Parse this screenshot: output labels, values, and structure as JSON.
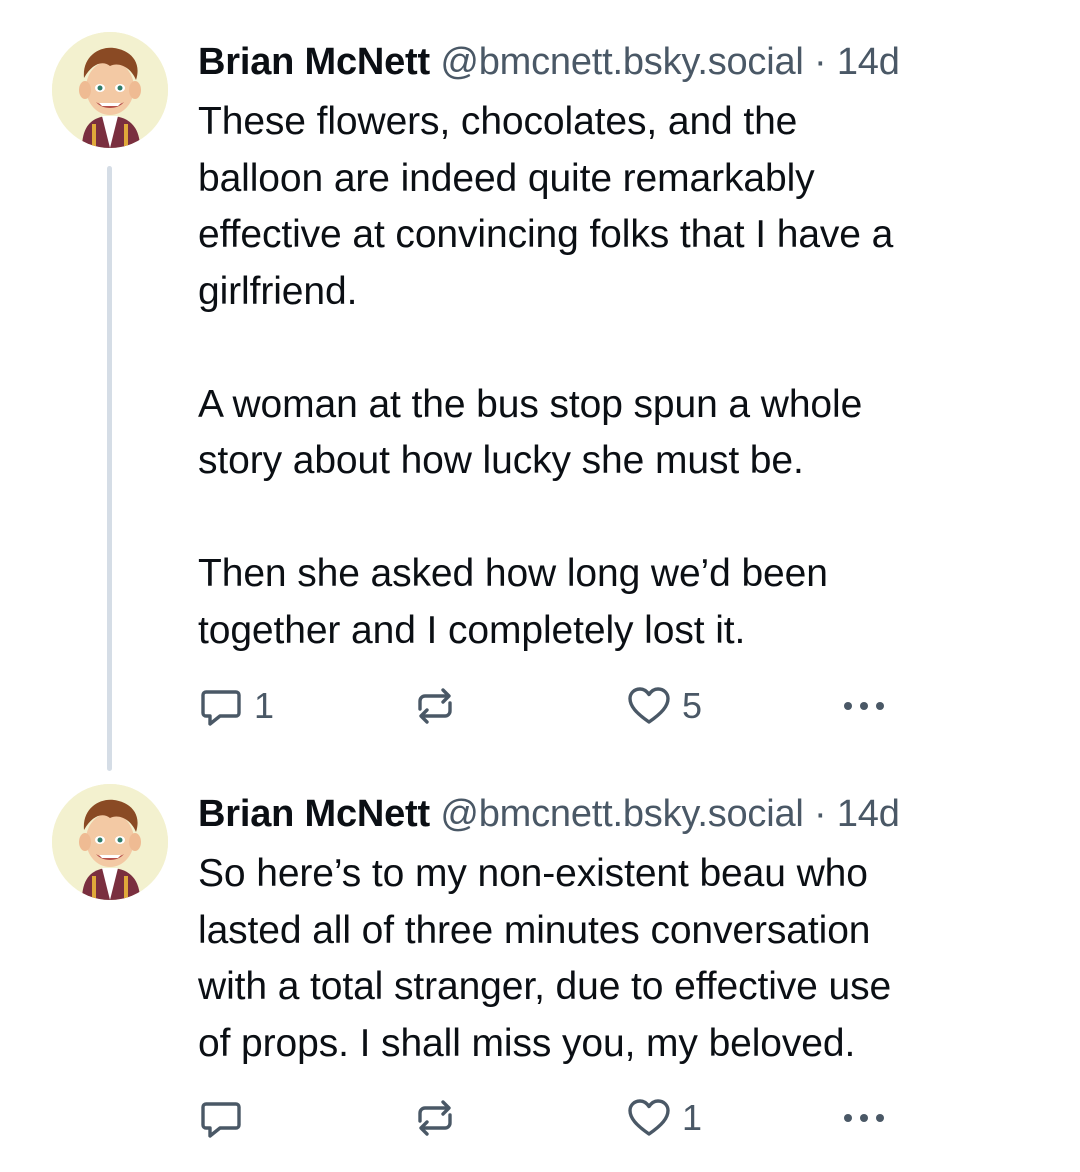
{
  "thread": {
    "posts": [
      {
        "author": {
          "display_name": "Brian McNett",
          "handle": "@bmcnett.bsky.social",
          "separator": "·",
          "time": "14d"
        },
        "text": "These flowers, chocolates, and the\nballoon are indeed quite remarkably\neffective at convincing folks that I have a\ngirlfriend.\n\nA woman at the bus stop spun a whole\nstory about how lucky she must be.\n\nThen she asked how long we’d been\ntogether and I completely lost it.",
        "actions": {
          "reply_count": "1",
          "repost_count": "",
          "like_count": "5",
          "reply_icon": "reply-icon",
          "repost_icon": "repost-icon",
          "like_icon": "heart-icon",
          "more_icon": "more-icon"
        }
      },
      {
        "author": {
          "display_name": "Brian McNett",
          "handle": "@bmcnett.bsky.social",
          "separator": "·",
          "time": "14d"
        },
        "text": "So here’s to my non-existent beau who\nlasted all of three minutes conversation\nwith a total stranger, due to effective use\nof props. I shall miss you, my beloved.",
        "actions": {
          "reply_count": "",
          "repost_count": "",
          "like_count": "1",
          "reply_icon": "reply-icon",
          "repost_icon": "repost-icon",
          "like_icon": "heart-icon",
          "more_icon": "more-icon"
        }
      }
    ]
  },
  "colors": {
    "text_primary": "#0b0f14",
    "text_secondary": "#4a5866",
    "thread_line": "#d5dde6",
    "avatar_background": "#f3f1cf"
  }
}
